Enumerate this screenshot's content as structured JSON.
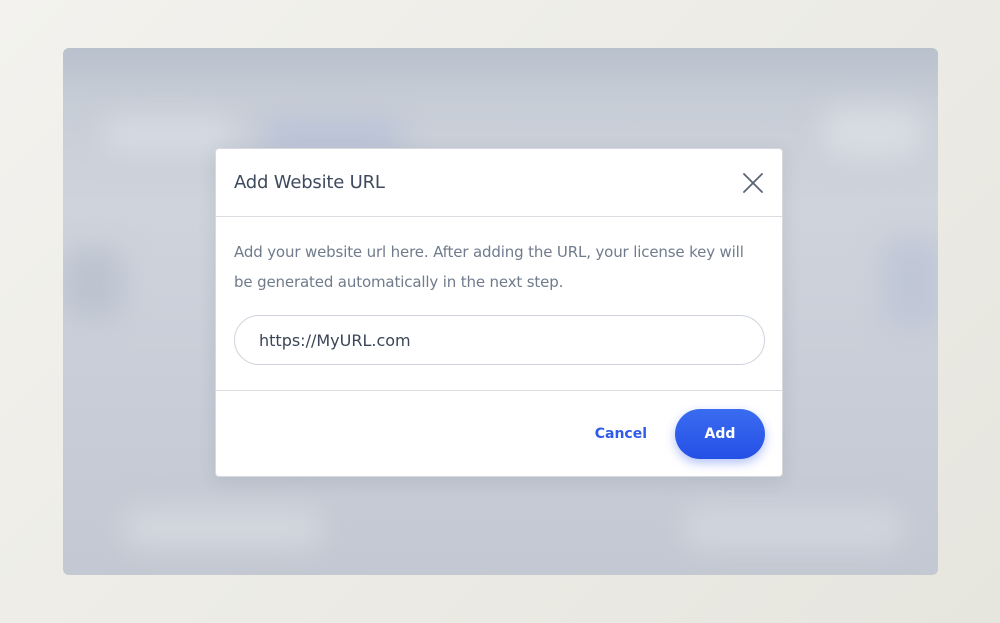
{
  "dialog": {
    "title": "Add Website URL",
    "description": "Add your website url here. After adding the URL, your license key will be generated automatically in the next step.",
    "url_input": {
      "value": "https://MyURL.com",
      "placeholder": ""
    },
    "cancel_label": "Cancel",
    "add_label": "Add",
    "close_icon": "close-icon"
  },
  "colors": {
    "accent": "#2f5bea",
    "title_text": "#3e4b5e",
    "body_text": "#707b8c"
  }
}
